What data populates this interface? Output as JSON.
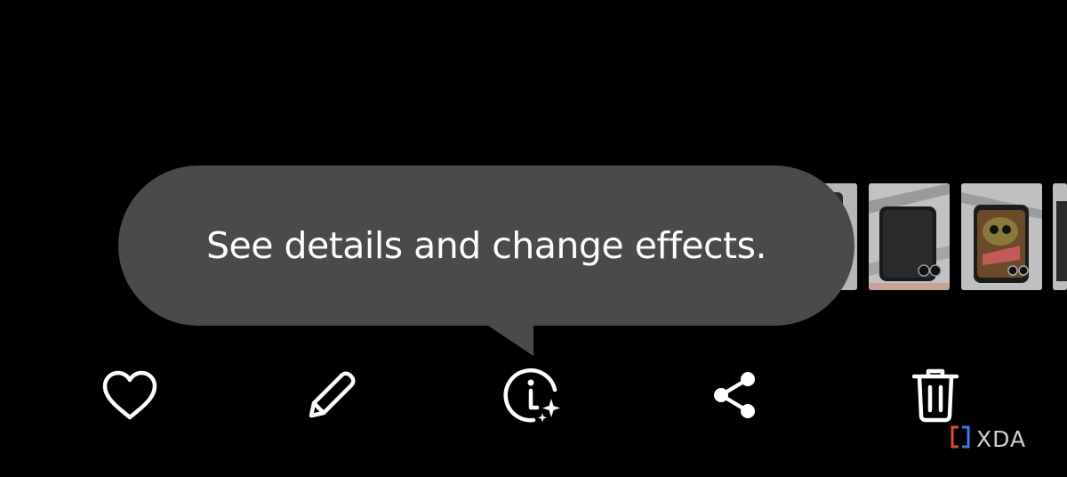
{
  "tooltip": {
    "text": "See details and change effects."
  },
  "toolbar": {
    "buttons": [
      {
        "name": "favorite-button",
        "icon": "heart-icon"
      },
      {
        "name": "edit-button",
        "icon": "pencil-icon"
      },
      {
        "name": "details-button",
        "icon": "info-sparkle-icon"
      },
      {
        "name": "share-button",
        "icon": "share-icon"
      },
      {
        "name": "delete-button",
        "icon": "trash-icon"
      }
    ]
  },
  "filmstrip": {
    "thumbnails": [
      "photo-thumbnail",
      "photo-thumbnail",
      "photo-thumbnail",
      "photo-thumbnail"
    ]
  },
  "watermark": {
    "text": "XDA",
    "logo_colors": [
      "#e24b3b",
      "#3d7be0"
    ]
  },
  "colors": {
    "background": "#000000",
    "tooltip_bg": "#4a4a4a",
    "icon": "#ffffff"
  }
}
